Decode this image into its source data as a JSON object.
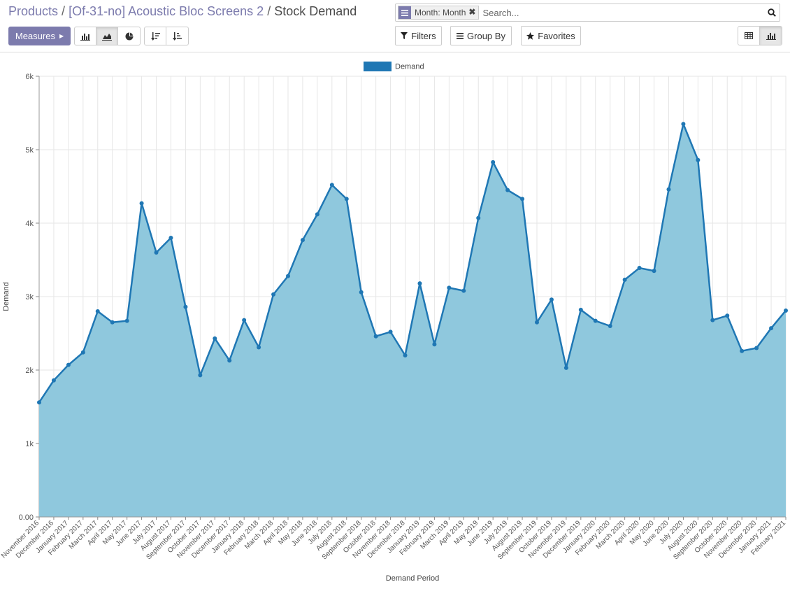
{
  "breadcrumb": {
    "items": [
      "Products",
      "[Of-31-no] Acoustic Bloc Screens 2"
    ],
    "separator": "/",
    "current": "Stock Demand"
  },
  "toolbar": {
    "measures_label": "Measures",
    "chart_type_buttons": [
      "bar-chart-icon",
      "line-chart-icon",
      "pie-chart-icon"
    ],
    "active_chart_type": "line-chart-icon",
    "sort_buttons": [
      "sort-descending-icon",
      "sort-ascending-icon"
    ]
  },
  "search": {
    "facet_label": "Month: Month",
    "placeholder": "Search...",
    "filters_label": "Filters",
    "group_by_label": "Group By",
    "favorites_label": "Favorites"
  },
  "view_switcher": {
    "views": [
      "pivot-view-icon",
      "graph-view-icon"
    ],
    "active_view": "graph-view-icon"
  },
  "colors": {
    "brand": "#7c7bad",
    "series_line": "#1f77b4",
    "series_fill": "#8fc8dd",
    "legend_swatch": "#1f77b4"
  },
  "chart_data": {
    "type": "area",
    "legend": [
      "Demand"
    ],
    "legend_position": "top-center",
    "xlabel": "Demand Period",
    "ylabel": "Demand",
    "ylim": [
      0,
      6000
    ],
    "yticks": [
      "0.00",
      "1k",
      "2k",
      "3k",
      "4k",
      "5k",
      "6k"
    ],
    "grid": true,
    "categories": [
      "November 2016",
      "December 2016",
      "January 2017",
      "February 2017",
      "March 2017",
      "April 2017",
      "May 2017",
      "June 2017",
      "July 2017",
      "August 2017",
      "September 2017",
      "October 2017",
      "November 2017",
      "December 2017",
      "January 2018",
      "February 2018",
      "March 2018",
      "April 2018",
      "May 2018",
      "June 2018",
      "July 2018",
      "August 2018",
      "September 2018",
      "October 2018",
      "November 2018",
      "December 2018",
      "January 2019",
      "February 2019",
      "March 2019",
      "April 2019",
      "May 2019",
      "June 2019",
      "July 2019",
      "August 2019",
      "September 2019",
      "October 2019",
      "November 2019",
      "December 2019",
      "January 2020",
      "February 2020",
      "March 2020",
      "April 2020",
      "May 2020",
      "June 2020",
      "July 2020",
      "August 2020",
      "September 2020",
      "October 2020",
      "November 2020",
      "December 2020",
      "January 2021",
      "February 2021"
    ],
    "series": [
      {
        "name": "Demand",
        "values": [
          1560,
          1860,
          2070,
          2240,
          2800,
          2650,
          2670,
          4270,
          3600,
          3800,
          2860,
          1930,
          2430,
          2130,
          2680,
          2310,
          3030,
          3280,
          3770,
          4120,
          4520,
          4330,
          3060,
          2460,
          2520,
          2200,
          3180,
          2350,
          3120,
          3080,
          4070,
          4830,
          4450,
          4330,
          2650,
          2960,
          2030,
          2820,
          2670,
          2600,
          3230,
          3390,
          3350,
          4460,
          5350,
          4860,
          2680,
          2740,
          2260,
          2300,
          2570,
          2810
        ]
      }
    ]
  }
}
